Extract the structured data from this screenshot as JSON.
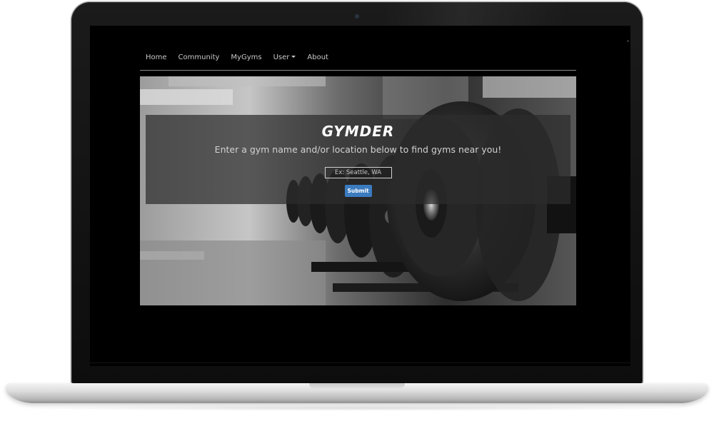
{
  "nav": {
    "items": [
      {
        "label": "Home"
      },
      {
        "label": "Community"
      },
      {
        "label": "MyGyms"
      },
      {
        "label": "User",
        "dropdown": true
      },
      {
        "label": "About"
      }
    ]
  },
  "hero": {
    "brand": "GYMDER",
    "tagline": "Enter a gym name and/or location below to find gyms near you!",
    "search": {
      "placeholder": "Ex: Seattle, WA",
      "value": ""
    },
    "submit_label": "Submit",
    "background_image": "black-and-white dumbbell rack photo"
  },
  "colors": {
    "page_background": "#000000",
    "accent_button": "#3b7bbf",
    "nav_text": "#c9c9c9",
    "overlay": "#2d2d2d"
  },
  "icons": {
    "user_dropdown": "chevron-down-icon",
    "webcam": "camera-icon"
  }
}
